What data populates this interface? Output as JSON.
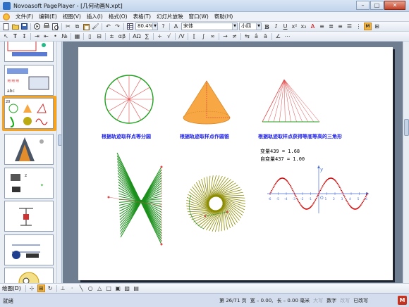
{
  "window": {
    "title": "Novoasoft PagePlayer - [几何动画N.xpt]",
    "minimize": "–",
    "maximize": "□",
    "close": "✕"
  },
  "menu": [
    "文件(F)",
    "编辑(E)",
    "视图(V)",
    "插入(I)",
    "格式(O)",
    "表格(T)",
    "幻灯片放映",
    "窗口(W)",
    "帮助(H)"
  ],
  "toolbar": {
    "zoom": "80.4%",
    "font": "宋体",
    "size": "小四",
    "bold": "B",
    "italic": "I",
    "underline": "U",
    "a_label": "A",
    "ab_label": "αβ",
    "omega_label": "AΩ"
  },
  "slide": {
    "captions": [
      "根据轨迹取样点等分圆",
      "根据轨迹取样点作圆锥",
      "根据轨迹取样点获得等底等高的三角形"
    ],
    "var1": "变量439 = 1.68",
    "var2": "自变量437 = 1.00",
    "axis_y": "y",
    "axis_o": "O",
    "x_ticks": [
      "-6",
      "-5",
      "-4",
      "-3",
      "-2",
      "-1",
      "1",
      "2",
      "3",
      "4",
      "5",
      "6"
    ]
  },
  "thumbs": {
    "nums": [
      "",
      "",
      "",
      "",
      "",
      "",
      "",
      ""
    ],
    "sel_label": "20"
  },
  "drawbar": {
    "label": "绘图(D)"
  },
  "status": {
    "left": "就绪",
    "page": "第 26/71 页",
    "width": "宽 – 0.00,",
    "height": "长 – 0.00 毫米",
    "caps": "大写",
    "num": "数字",
    "ovr": "改写",
    "ext": "已改写",
    "brand": "M"
  },
  "colors": {
    "accent": "#f7a31c",
    "caption": "#1f22e6",
    "pie": "#1ea21e",
    "cone": "#f7a845",
    "curve": "#8c8c00",
    "sine": "#d20000"
  }
}
